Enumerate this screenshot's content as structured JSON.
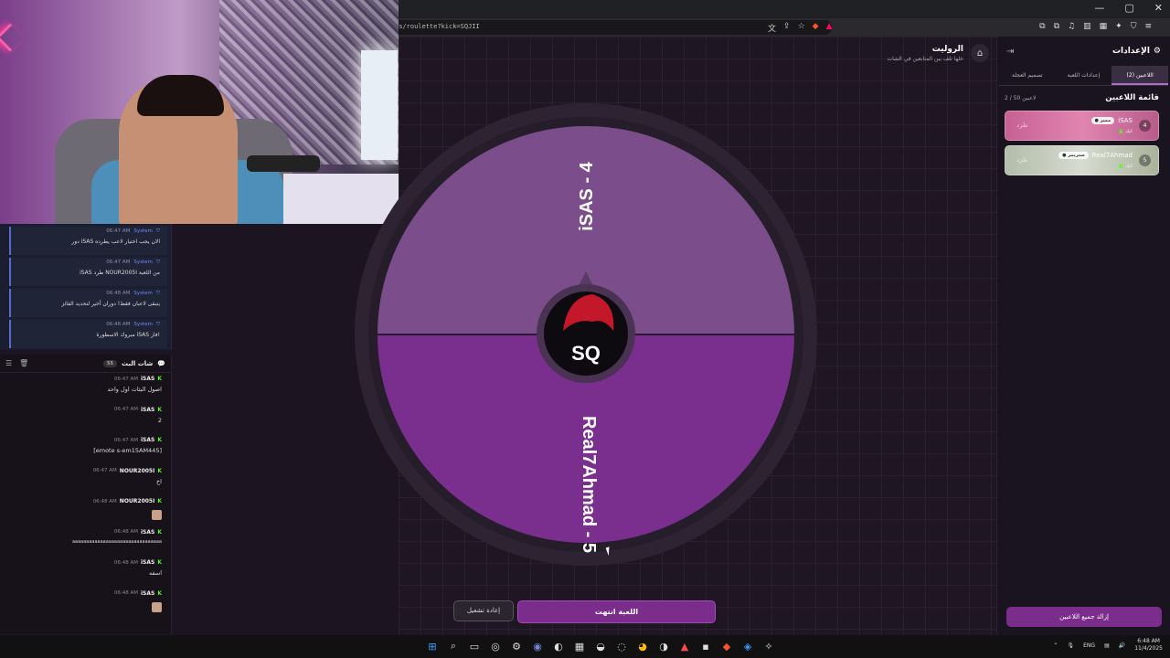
{
  "browser": {
    "url": "es/roulette?kick=SQJII",
    "window_controls": [
      "—",
      "▢",
      "✕"
    ]
  },
  "system_log": {
    "messages": [
      {
        "sender": "System",
        "time": "06:47 AM",
        "text": "دور iSAS الان يجب اختيار لاعب يطرده"
      },
      {
        "sender": "System",
        "time": "06:47 AM",
        "text": "iSAS طرد NOUR2005I من اللعبة"
      },
      {
        "sender": "System",
        "time": "06:48 AM",
        "text": "يتبقى لاعبان فقط! دوران أخير لتحديد الفائز"
      },
      {
        "sender": "System",
        "time": "06:48 AM",
        "text": "مبروك الاسطورة iSAS فاز!"
      }
    ]
  },
  "chat": {
    "title": "شات البث",
    "count": "55",
    "messages": [
      {
        "user": "iSAS",
        "time": "06:47 AM",
        "text": "اصول البثات اول واحد"
      },
      {
        "user": "iSAS",
        "time": "06:47 AM",
        "text": "2"
      },
      {
        "user": "iSAS",
        "time": "06:47 AM",
        "text": "[emote s-em15AM445]"
      },
      {
        "user": "NOUR2005I",
        "time": "06:47 AM",
        "text": "اخ"
      },
      {
        "user": "NOUR2005I",
        "time": "06:48 AM",
        "text": ""
      },
      {
        "user": "iSAS",
        "time": "06:48 AM",
        "text": "aaaaaaaaaaaaaaaaaaaaaaaaaaaaaaaa"
      },
      {
        "user": "iSAS",
        "time": "06:48 AM",
        "text": "اسفه"
      },
      {
        "user": "iSAS",
        "time": "06:48 AM",
        "text": ""
      }
    ]
  },
  "page": {
    "title": "الروليت",
    "subtitle": "خلها تلف بين المتابعين في الشات"
  },
  "wheel": {
    "segments": [
      {
        "label": "iSAS - 4",
        "color": "#7b4d8b"
      },
      {
        "label": "Real7Ahmad - 5",
        "color": "#7a2e8e"
      }
    ],
    "center_logo": "SQ"
  },
  "buttons": {
    "game_over": "اللعبة انتهت",
    "replay": "إعادة تشغيل",
    "clear_all": "إزالة جميع اللاعبين"
  },
  "settings": {
    "title": "الإعدادات",
    "tabs": [
      "اللاعبين (2)",
      "إعدادات اللعبة",
      "تصميم العجلة"
    ],
    "players_title": "قائمة اللاعبين",
    "players_count": "2 / 50 لاعبين",
    "players": [
      {
        "num": "4",
        "name": "iSAS",
        "badge": "● مميز",
        "platform": "كيك",
        "kick": "طرد"
      },
      {
        "num": "5",
        "name": "Real7Ahmad",
        "badge": "● ستريمر",
        "platform": "كيك",
        "kick": "طرد"
      }
    ]
  },
  "taskbar": {
    "lang": "ENG",
    "time": "6:48 AM",
    "date": "11/4/2025"
  }
}
